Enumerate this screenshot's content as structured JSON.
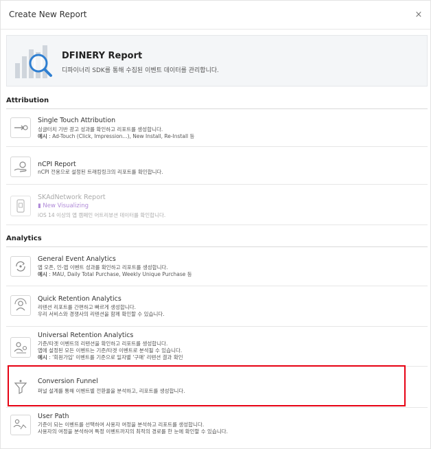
{
  "modal": {
    "title": "Create New Report",
    "close_label": "×"
  },
  "banner": {
    "title": "DFINERY Report",
    "description": "디파이너리 SDK를 통해 수집된 이벤트 데이터를 관리합니다."
  },
  "sections": {
    "attribution": "Attribution",
    "analytics": "Analytics"
  },
  "items": {
    "single_touch": {
      "name": "Single Touch Attribution",
      "desc1": "싱글터치 기반 광고 성과를 확인하고 리포트를 생성합니다.",
      "desc2_prefix": "예시",
      "desc2": " : Ad-Touch (Click, Impression...), New Install, Re-Install 등"
    },
    "ncpi": {
      "name": "nCPI Report",
      "desc1": "nCPI 전용으로 설정된 트래킹링크의 리포트를 확인합니다."
    },
    "skad": {
      "name": "SKAdNetwork Report",
      "badge": "New Visualizing",
      "desc1": "iOS 14 이상의 앱 캠페인 어트리뷰션 데이터를 확인합니다."
    },
    "general_event": {
      "name": "General Event Analytics",
      "desc1": "앱 오픈, 인-앱 이벤트 성과를 확인하고 리포트를 생성합니다.",
      "desc2_prefix": "예시",
      "desc2": " : MAU, Daily Total Purchase, Weekly Unique Purchase 등"
    },
    "quick_retention": {
      "name": "Quick Retention Analytics",
      "desc1": "리텐션 리포트를 간편하고 빠르게 생성합니다.",
      "desc2": "우리 서비스와 경쟁사의 리텐션을 함께 확인할 수 있습니다."
    },
    "universal_retention": {
      "name": "Universal Retention Analytics",
      "desc1": "기준/타겟 이벤트의 리텐션을 확인하고 리포트를 생성합니다.",
      "desc2": "앱에 설정된 모든 이벤트는 기준/타겟 이벤트로 분석될 수 있습니다.",
      "desc3_prefix": "예시",
      "desc3": " : '회원가입' 이벤트를 기준으로 일자별 '구매' 리텐션 결과 확인"
    },
    "conversion_funnel": {
      "name": "Conversion Funnel",
      "desc1": "퍼널 설계를 통해 이벤트별 전환율을 분석하고, 리포트를 생성합니다."
    },
    "user_path": {
      "name": "User Path",
      "desc1": "기준이 되는 이벤트를 선택하여 사용자 여정을 분석하고 리포트를 생성합니다.",
      "desc2": "사용자의 여정을 분석하여 특정 이벤트까지의 최적의 경로를 한 눈에 확인할 수 있습니다."
    }
  },
  "colors": {
    "highlight_border": "#e60012",
    "badge": "#b08ad8",
    "banner_bg": "#f4f6f8",
    "magnifier": "#2f7fd1"
  },
  "icons": {
    "banner": "report-chart-magnifier-icon",
    "single_touch": "touch-arrow-icon",
    "ncpi": "hand-coin-icon",
    "skad": "phone-icon",
    "general_event": "cycle-event-icon",
    "quick_retention": "retention-user-icon",
    "universal_retention": "users-target-icon",
    "conversion_funnel": "funnel-icon",
    "user_path": "user-path-icon"
  }
}
